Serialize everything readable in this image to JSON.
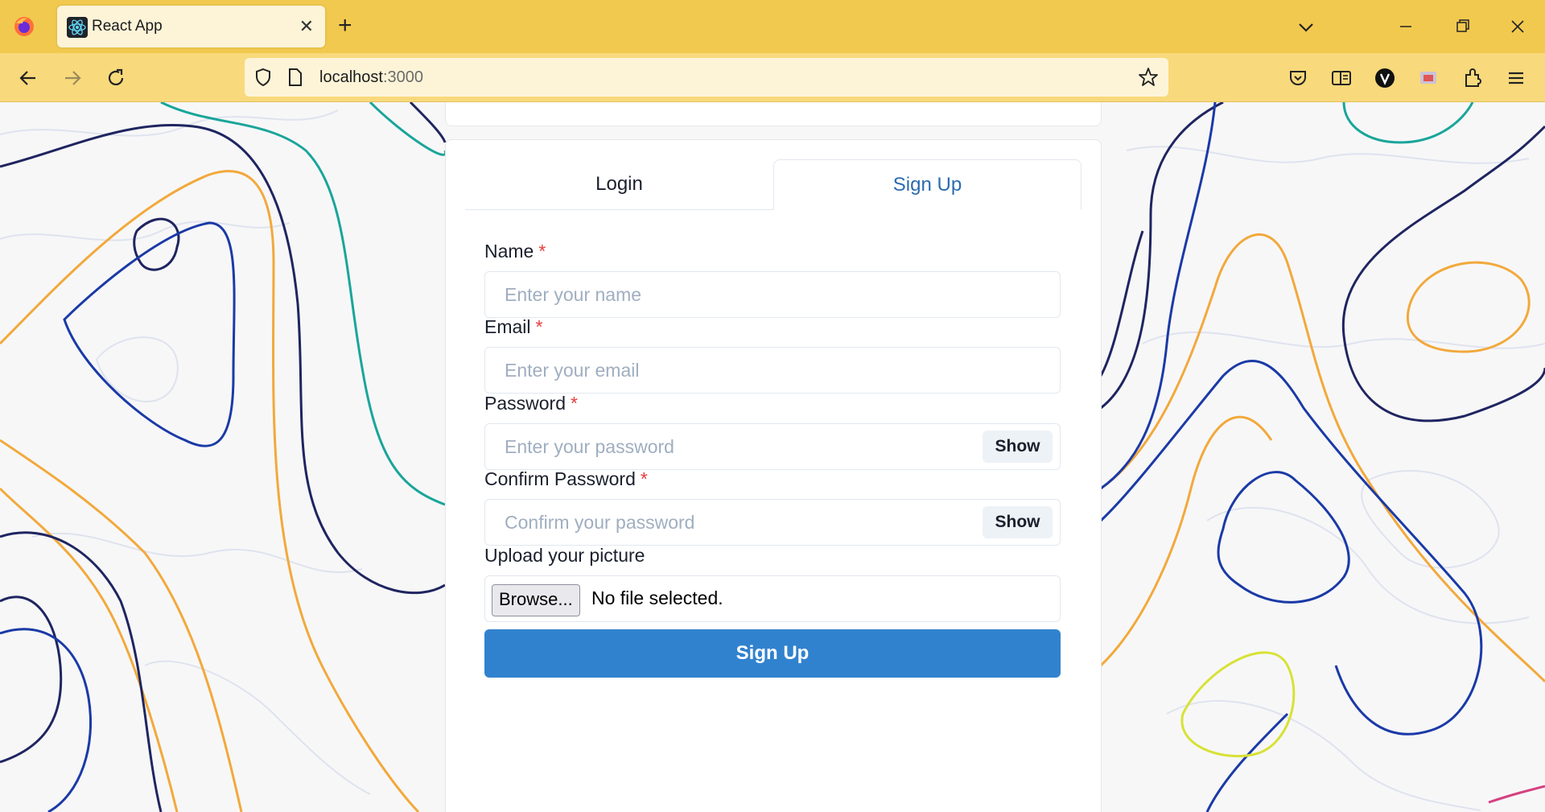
{
  "browser": {
    "tab_title": "React App",
    "tab_close": "✕",
    "new_tab": "+",
    "url_host": "localhost",
    "url_port": ":3000"
  },
  "auth": {
    "tabs": [
      {
        "label": "Login",
        "active": false
      },
      {
        "label": "Sign Up",
        "active": true
      }
    ],
    "fields": {
      "name": {
        "label": "Name",
        "required_mark": "*",
        "placeholder": "Enter your name"
      },
      "email": {
        "label": "Email",
        "required_mark": "*",
        "placeholder": "Enter your email"
      },
      "password": {
        "label": "Password",
        "required_mark": "*",
        "placeholder": "Enter your password",
        "toggle_label": "Show"
      },
      "confirm_password": {
        "label": "Confirm Password",
        "required_mark": "*",
        "placeholder": "Confirm your password",
        "toggle_label": "Show"
      },
      "picture": {
        "label": "Upload your picture",
        "browse_label": "Browse...",
        "status": "No file selected."
      }
    },
    "submit_label": "Sign Up"
  },
  "colors": {
    "chrome_tabbar": "#f2c94f",
    "chrome_toolbar": "#f8d97b",
    "accent": "#3182ce",
    "active_tab_text": "#2b6cb0",
    "required": "#e53e3e"
  },
  "icons": [
    "firefox-icon",
    "react-icon",
    "close-icon",
    "plus-icon",
    "chevron-down-icon",
    "minimize-icon",
    "restore-icon",
    "window-close-icon",
    "back-arrow-icon",
    "forward-arrow-icon",
    "reload-icon",
    "shield-icon",
    "page-icon",
    "star-icon",
    "pocket-icon",
    "reader-view-icon",
    "account-icon",
    "cast-icon",
    "extensions-icon",
    "menu-icon"
  ]
}
